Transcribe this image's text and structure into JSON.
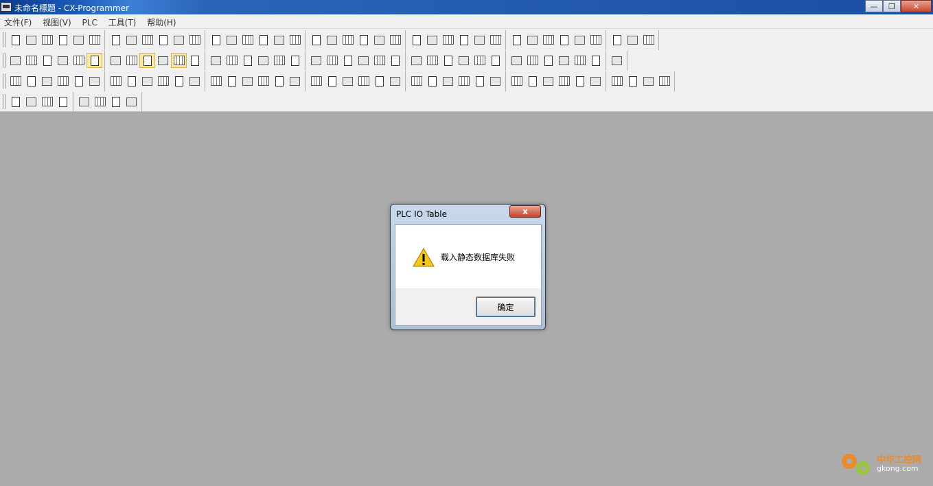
{
  "window": {
    "title": "未命名標題 - CX-Programmer",
    "minimize_glyph": "—",
    "restore_glyph": "❐",
    "close_glyph": "✕"
  },
  "menu": [
    "文件(F)",
    "视图(V)",
    "PLC",
    "工具(T)",
    "帮助(H)"
  ],
  "toolbar_rows": [
    [
      "new-file-icon",
      "open-folder-icon",
      "save-icon",
      "print-preview-icon",
      "print-icon",
      "page-preview-icon",
      "cut-icon",
      "copy-icon",
      "paste-icon",
      "clipboard-icon",
      "undo-icon",
      "redo-icon",
      "find-icon",
      "replace-icon",
      "find-next-icon",
      "cross-reference-icon",
      "info-icon",
      "help-icon",
      "context-help-icon",
      "online-icon",
      "download-icon",
      "upload-icon",
      "compare-icon",
      "transfer-icon",
      "monitor-icon",
      "pause-icon",
      "program-icon",
      "compile-icon",
      "check-icon",
      "network-icon",
      "setup-icon",
      "io-table-icon",
      "memory-icon",
      "unit-icon",
      "rack-icon",
      "data-icon",
      "trace-icon",
      "force-icon",
      "link-icon"
    ],
    [
      "zoom-icon",
      "cut-section-icon",
      "zoom-in-icon",
      "zoom-out-icon",
      "grid-icon",
      "symbol-icon",
      "list-icon",
      "ladder-icon",
      "mnemonic-icon",
      "tree-icon",
      "sfc-icon",
      "ci-icon",
      "select-icon",
      "contact-no-icon",
      "contact-nc-icon",
      "or-contact-icon",
      "or-nc-contact-icon",
      "vertical-line-icon",
      "horizontal-line-icon",
      "coil-icon",
      "nc-coil-icon",
      "function-block-icon",
      "instruction-icon",
      "branch-icon",
      "corner-icon",
      "delete-line-icon",
      "rung-icon",
      "section-icon",
      "program-block-icon",
      "cross-icon",
      "split-icon",
      "edit-icon",
      "view-icon",
      "table-icon",
      "window-icon",
      "compare-view-icon",
      "check-view-icon"
    ],
    [
      "project-icon",
      "graph-icon",
      "chart-icon",
      "diagram-icon",
      "tiles-icon",
      "properties-icon",
      "symbols-icon",
      "address-icon",
      "comment-icon",
      "block-icon",
      "memory-view-icon",
      "decimal-10-icon",
      "signed-10-icon",
      "hex-16-icon",
      "up-icon",
      "down-icon",
      "force-set-icon",
      "monitor-view-icon",
      "watch-icon",
      "trace-view-icon",
      "hand-icon",
      "hand-stop-icon",
      "play-icon",
      "stop-icon",
      "pause-run-icon",
      "step-icon",
      "step-into-icon",
      "step-out-icon",
      "fast-forward-icon",
      "run-to-end-icon",
      "io-view-icon",
      "bus-icon",
      "port-icon",
      "unit-view-icon",
      "branch-up-icon",
      "branch-down-icon",
      "bus-split-icon",
      "bus-merge-icon",
      "bus-end-icon",
      "return-icon"
    ],
    [
      "indent-left-icon",
      "indent-right-icon",
      "align-left-icon",
      "align-right-icon",
      "pen-icon",
      "tool-1-icon",
      "tool-2-icon",
      "tool-3-icon"
    ]
  ],
  "dialog": {
    "title": "PLC IO Table",
    "close_glyph": "x",
    "message": "载入静态数据库失败",
    "ok_label": "确定",
    "icon": "warning-icon"
  },
  "watermark": {
    "line1": "中华工控网",
    "line2": "gkong.com"
  },
  "colors": {
    "titlebar": "#1a4fa3",
    "workspace": "#ababab",
    "warning": "#f5c518",
    "watermark_orange": "#e98a2b"
  }
}
